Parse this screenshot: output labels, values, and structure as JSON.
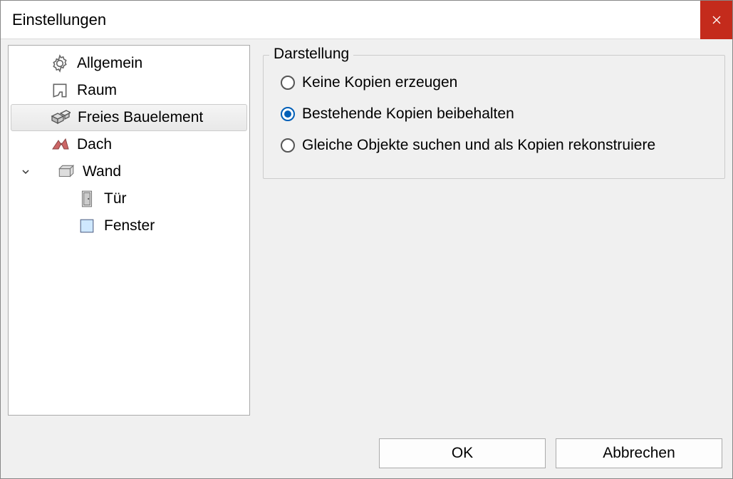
{
  "dialog": {
    "title": "Einstellungen"
  },
  "tree": {
    "items": [
      {
        "id": "general",
        "label": "Allgemein",
        "icon": "gear-icon"
      },
      {
        "id": "room",
        "label": "Raum",
        "icon": "room-icon"
      },
      {
        "id": "free-element",
        "label": "Freies Bauelement",
        "icon": "cube-icon",
        "selected": true
      },
      {
        "id": "roof",
        "label": "Dach",
        "icon": "roof-icon"
      },
      {
        "id": "wall",
        "label": "Wand",
        "icon": "wall-icon",
        "expanded": true,
        "children": [
          {
            "id": "door",
            "label": "Tür",
            "icon": "door-icon"
          },
          {
            "id": "window",
            "label": "Fenster",
            "icon": "window-icon"
          }
        ]
      }
    ]
  },
  "panel": {
    "group_title": "Darstellung",
    "options": [
      {
        "id": "no-copies",
        "label": "Keine Kopien erzeugen",
        "checked": false
      },
      {
        "id": "keep-copies",
        "label": "Bestehende Kopien beibehalten",
        "checked": true
      },
      {
        "id": "reconstruct-copies",
        "label": "Gleiche Objekte suchen und als Kopien rekonstruiere",
        "checked": false
      }
    ]
  },
  "footer": {
    "ok_label": "OK",
    "cancel_label": "Abbrechen"
  }
}
